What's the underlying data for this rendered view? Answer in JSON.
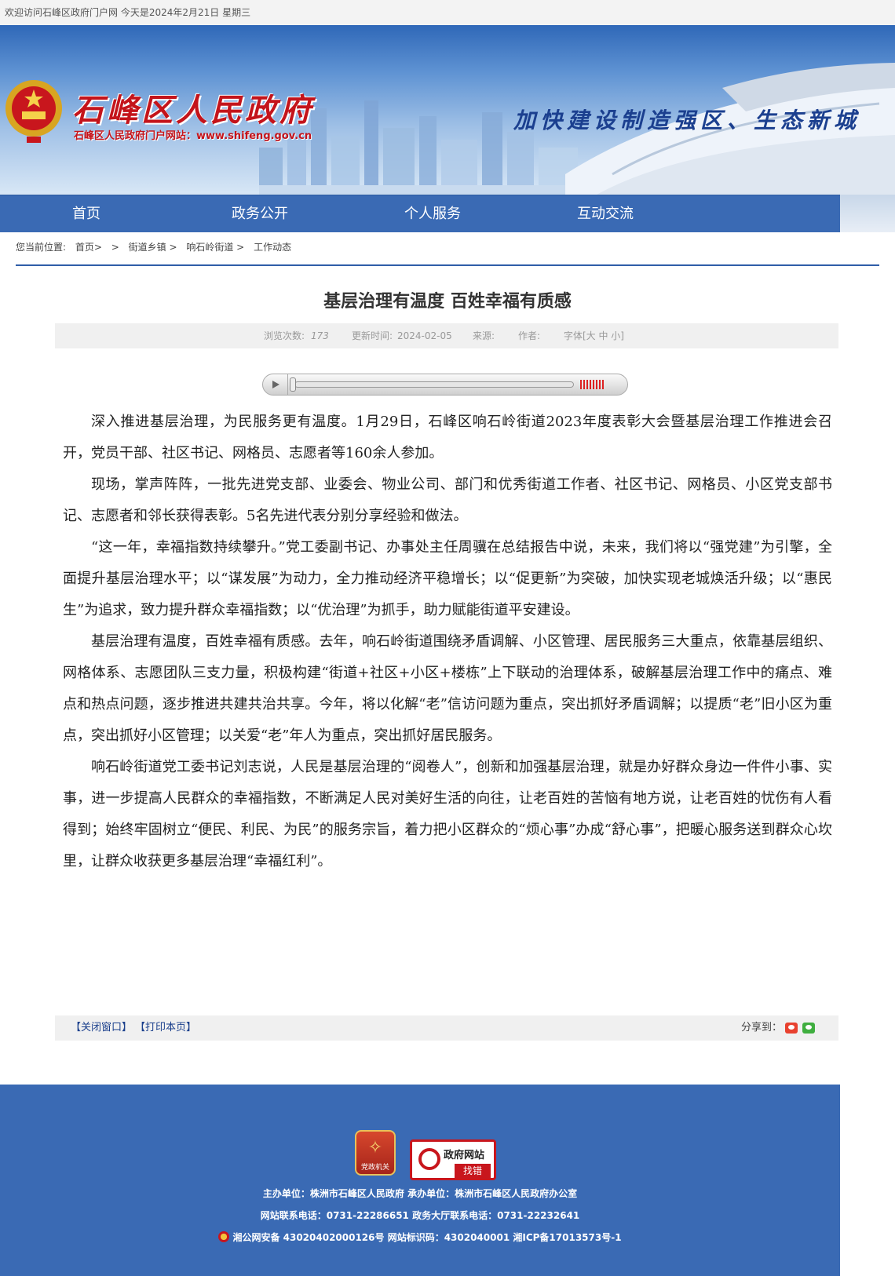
{
  "topbar": {
    "text": "欢迎访问石峰区政府门户网 今天是2024年2月21日 星期三"
  },
  "header": {
    "site_title": "石峰区人民政府",
    "site_subtitle": "石峰区人民政府门户网站：www.shifeng.gov.cn",
    "slogan": "加快建设制造强区、生态新城"
  },
  "nav": {
    "items": [
      {
        "label": "首页"
      },
      {
        "label": "政务公开"
      },
      {
        "label": "个人服务"
      },
      {
        "label": "互动交流"
      }
    ]
  },
  "breadcrumb": {
    "prefix": "您当前位置:",
    "items": [
      "首页>",
      ">",
      "街道乡镇 >",
      "响石岭街道 >",
      "工作动态"
    ]
  },
  "article": {
    "title": "基层治理有温度 百姓幸福有质感",
    "meta": {
      "views_label": "浏览次数:",
      "views": "173",
      "updated_label": "更新时间:",
      "updated": "2024-02-05",
      "source_label": "来源:",
      "author_label": "作者:",
      "font_label": "字体[大 中 小]"
    },
    "paragraphs": [
      "深入推进基层治理，为民服务更有温度。1月29日，石峰区响石岭街道2023年度表彰大会暨基层治理工作推进会召开，党员干部、社区书记、网格员、志愿者等160余人参加。",
      "现场，掌声阵阵，一批先进党支部、业委会、物业公司、部门和优秀街道工作者、社区书记、网格员、小区党支部书记、志愿者和邻长获得表彰。5名先进代表分别分享经验和做法。",
      "“这一年，幸福指数持续攀升。”党工委副书记、办事处主任周骥在总结报告中说，未来，我们将以“强党建”为引擎，全面提升基层治理水平；以“谋发展”为动力，全力推动经济平稳增长；以“促更新”为突破，加快实现老城焕活升级；以“惠民生”为追求，致力提升群众幸福指数；以“优治理”为抓手，助力赋能街道平安建设。",
      "基层治理有温度，百姓幸福有质感。去年，响石岭街道围绕矛盾调解、小区管理、居民服务三大重点，依靠基层组织、网格体系、志愿团队三支力量，积极构建“街道+社区+小区+楼栋”上下联动的治理体系，破解基层治理工作中的痛点、难点和热点问题，逐步推进共建共治共享。今年，将以化解“老”信访问题为重点，突出抓好矛盾调解；以提质“老”旧小区为重点，突出抓好小区管理；以关爱“老”年人为重点，突出抓好居民服务。",
      "响石岭街道党工委书记刘志说，人民是基层治理的“阅卷人”，创新和加强基层治理，就是办好群众身边一件件小事、实事，进一步提高人民群众的幸福指数，不断满足人民对美好生活的向往，让老百姓的苦恼有地方说，让老百姓的忧伤有人看得到；始终牢固树立“便民、利民、为民”的服务宗旨，着力把小区群众的“烦心事”办成“舒心事”，把暖心服务送到群众心坎里，让群众收获更多基层治理“幸福红利”。"
    ]
  },
  "actions": {
    "close_label": "【关闭窗口】",
    "print_label": "【打印本页】",
    "share_label": "分享到："
  },
  "footer": {
    "party_badge": "党政机关",
    "error_badge_title": "政府网站",
    "error_badge_btn": "找错",
    "line1": "主办单位：株洲市石峰区人民政府 承办单位：株洲市石峰区人民政府办公室",
    "line2": "网站联系电话：0731-22286651 政务大厅联系电话：0731-22232641",
    "line3": "湘公网安备 43020402000126号 网站标识码：4302040001 湘ICP备17013573号-1"
  },
  "colors": {
    "nav_blue": "#3a6ab4",
    "title_red": "#c4141b",
    "link_blue": "#1a3f8c"
  }
}
